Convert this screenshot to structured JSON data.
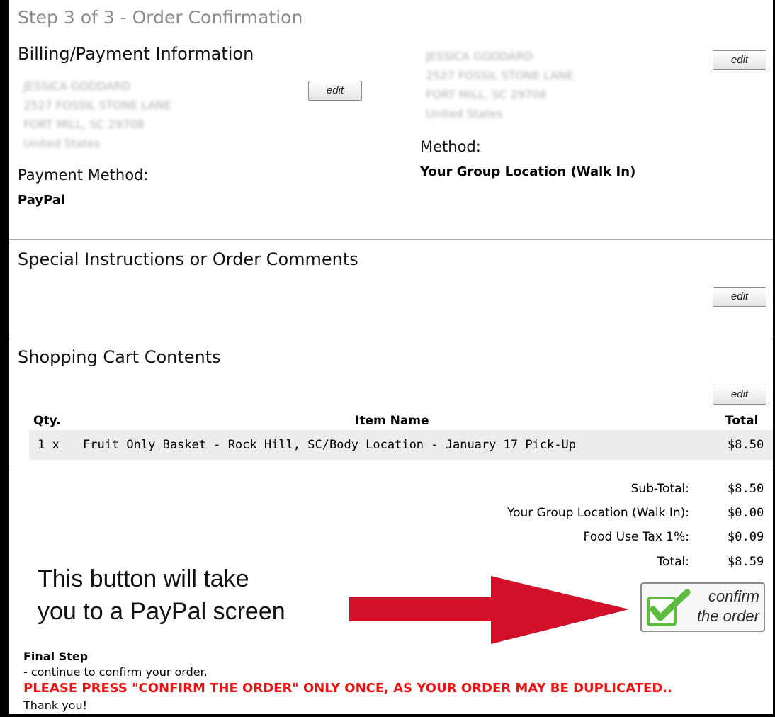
{
  "header": {
    "step_title": "Step 3 of 3 - Order Confirmation"
  },
  "billing": {
    "heading": "Billing/Payment Information",
    "address_lines": [
      "JESSICA GODDARD",
      "2527 FOSSIL STONE LANE",
      "FORT MILL, SC 29708",
      "United States"
    ],
    "edit_label": "edit",
    "payment_method_heading": "Payment Method:",
    "payment_method_value": "PayPal"
  },
  "shipping": {
    "address_lines": [
      "JESSICA GODDARD",
      "2527 FOSSIL STONE LANE",
      "FORT MILL, SC 29708",
      "United States"
    ],
    "edit_label": "edit",
    "method_heading": "Method:",
    "method_value": "Your Group Location (Walk In)"
  },
  "comments": {
    "heading": "Special Instructions or Order Comments",
    "edit_label": "edit"
  },
  "cart": {
    "heading": "Shopping Cart Contents",
    "edit_label": "edit",
    "columns": {
      "qty": "Qty.",
      "item": "Item Name",
      "total": "Total"
    },
    "items": [
      {
        "qty": "1 x",
        "name": "Fruit Only Basket - Rock Hill, SC/Body Location - January 17 Pick-Up",
        "total": "$8.50"
      }
    ]
  },
  "totals": [
    {
      "label": "Sub-Total:",
      "value": "$8.50"
    },
    {
      "label": "Your Group Location (Walk In):",
      "value": "$0.00"
    },
    {
      "label": "Food Use Tax 1%:",
      "value": "$0.09"
    },
    {
      "label": "Total:",
      "value": "$8.59"
    }
  ],
  "annotation": {
    "line1": "This button will take",
    "line2": "you to a PayPal screen",
    "arrow_color": "#d2102a"
  },
  "confirm_button": {
    "line1": "confirm",
    "line2": "the order",
    "check_color": "#5dbb3f"
  },
  "footer": {
    "final_step_heading": "Final Step",
    "final_step_text": "- continue to confirm your order.",
    "warning": "PLEASE PRESS \"CONFIRM THE ORDER\" ONLY ONCE, AS YOUR ORDER MAY BE DUPLICATED..",
    "thanks": "Thank you!"
  },
  "colors": {
    "warning": "#ee1111",
    "title_gray": "#8a8a8a",
    "row_bg": "#ededed"
  }
}
